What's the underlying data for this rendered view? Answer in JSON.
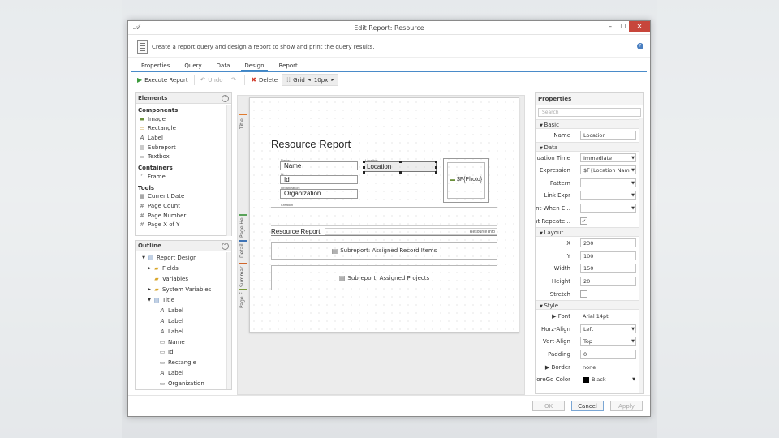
{
  "window": {
    "title": "Edit Report: Resource",
    "minimize": "–",
    "maximize": "☐",
    "close": "✕"
  },
  "header": {
    "description": "Create a report query and design a report to show and print the query results."
  },
  "tabs": [
    "Properties",
    "Query",
    "Data",
    "Design",
    "Report"
  ],
  "toolbar": {
    "execute": "Execute Report",
    "undo": "Undo",
    "delete": "Delete",
    "grid": "Grid",
    "grid_prev": "◂",
    "grid_size": "10px",
    "grid_next": "▸"
  },
  "elements": {
    "title": "Elements",
    "groups": [
      {
        "name": "Components",
        "items": [
          {
            "label": "Image",
            "icon": "▬"
          },
          {
            "label": "Rectangle",
            "icon": "▭"
          },
          {
            "label": "Label",
            "icon": "A"
          },
          {
            "label": "Subreport",
            "icon": "▤"
          },
          {
            "label": "Textbox",
            "icon": "▭"
          }
        ]
      },
      {
        "name": "Containers",
        "items": [
          {
            "label": "Frame",
            "icon": "⌜"
          }
        ]
      },
      {
        "name": "Tools",
        "items": [
          {
            "label": "Current Date",
            "icon": "▦"
          },
          {
            "label": "Page Count",
            "icon": "#"
          },
          {
            "label": "Page Number",
            "icon": "#"
          },
          {
            "label": "Page X of Y",
            "icon": "#"
          }
        ]
      }
    ]
  },
  "outline": {
    "title": "Outline",
    "items": [
      {
        "label": "Report Design",
        "depth": 0,
        "arrow": "▼",
        "icon": "▤"
      },
      {
        "label": "Fields",
        "depth": 1,
        "arrow": "▶",
        "icon": "▰"
      },
      {
        "label": "Variables",
        "depth": 1,
        "arrow": "",
        "icon": "▰"
      },
      {
        "label": "System Variables",
        "depth": 1,
        "arrow": "▶",
        "icon": "▰"
      },
      {
        "label": "Title",
        "depth": 1,
        "arrow": "▼",
        "icon": "▤"
      },
      {
        "label": "Label",
        "depth": 2,
        "arrow": "",
        "icon": "A"
      },
      {
        "label": "Label",
        "depth": 2,
        "arrow": "",
        "icon": "A"
      },
      {
        "label": "Label",
        "depth": 2,
        "arrow": "",
        "icon": "A"
      },
      {
        "label": "Name",
        "depth": 2,
        "arrow": "",
        "icon": "▭"
      },
      {
        "label": "Id",
        "depth": 2,
        "arrow": "",
        "icon": "▭"
      },
      {
        "label": "Rectangle",
        "depth": 2,
        "arrow": "",
        "icon": "▭"
      },
      {
        "label": "Label",
        "depth": 2,
        "arrow": "",
        "icon": "A"
      },
      {
        "label": "Organization",
        "depth": 2,
        "arrow": "",
        "icon": "▭"
      }
    ]
  },
  "designer": {
    "bands": [
      {
        "label": "Title",
        "color": "#e07a2e"
      },
      {
        "label": "Page He",
        "color": "#5aa35a"
      },
      {
        "label": "Detail",
        "color": "#3e73b6"
      },
      {
        "label": "Summar",
        "color": "#d0652a"
      },
      {
        "label": "Page F",
        "color": "#7a9a3a"
      }
    ],
    "report_title": "Resource Report",
    "name_caption": "Name:",
    "name_value": "Name",
    "id_caption": "Id:",
    "id_value": "Id",
    "org_caption": "Organization:",
    "org_value": "Organization",
    "location_caption": "Location:",
    "location_value": "Location",
    "photo_field": "$F{Photo}",
    "creation_caption": "Creation",
    "page_header_title": "Resource Report",
    "page_header_info": "Resource Info",
    "subreport1": "Subreport: Assigned Record Items",
    "subreport2": "Subreport: Assigned Projects"
  },
  "properties": {
    "title": "Properties",
    "search_placeholder": "Search",
    "categories": [
      {
        "name": "Basic",
        "rows": [
          {
            "label": "Name",
            "value": "Location",
            "kind": "text"
          }
        ]
      },
      {
        "name": "Data",
        "rows": [
          {
            "label": "Evaluation Time",
            "value": "Immediate",
            "kind": "dropdown"
          },
          {
            "label": "Expression",
            "value": "$F{Location Nam",
            "kind": "dropdown"
          },
          {
            "label": "Pattern",
            "value": "",
            "kind": "dropdown"
          },
          {
            "label": "Link Expr",
            "value": "",
            "kind": "dropdown"
          },
          {
            "label": "Print-When E...",
            "value": "",
            "kind": "dropdown"
          },
          {
            "label": "Print Repeate...",
            "value": "✓",
            "kind": "check"
          }
        ]
      },
      {
        "name": "Layout",
        "rows": [
          {
            "label": "X",
            "value": "230",
            "kind": "text"
          },
          {
            "label": "Y",
            "value": "100",
            "kind": "text"
          },
          {
            "label": "Width",
            "value": "150",
            "kind": "text"
          },
          {
            "label": "Height",
            "value": "20",
            "kind": "text"
          },
          {
            "label": "Stretch",
            "value": "",
            "kind": "check"
          }
        ]
      },
      {
        "name": "Style",
        "rows": [
          {
            "label": "▶ Font",
            "value": "Arial 14pt",
            "kind": "plain"
          },
          {
            "label": "Horz-Align",
            "value": "Left",
            "kind": "dropdown"
          },
          {
            "label": "Vert-Align",
            "value": "Top",
            "kind": "dropdown"
          },
          {
            "label": "Padding",
            "value": "0",
            "kind": "text"
          },
          {
            "label": "▶ Border",
            "value": "none",
            "kind": "plain"
          },
          {
            "label": "ForeGd Color",
            "value": "Black",
            "kind": "color"
          }
        ]
      }
    ]
  },
  "footer": {
    "ok": "OK",
    "cancel": "Cancel",
    "apply": "Apply"
  }
}
